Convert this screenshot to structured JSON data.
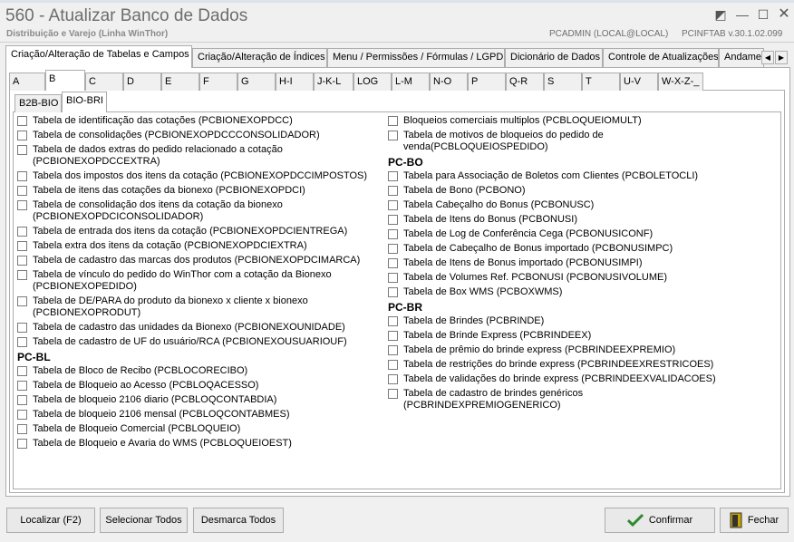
{
  "window": {
    "title": "560 - Atualizar Banco de Dados",
    "subtitle": "Distribuição e Varejo (Linha WinThor)",
    "user": "PCADMIN (LOCAL@LOCAL)",
    "module": "PCINFTAB  v.30.1.02.099",
    "controls": {
      "restore": "◩",
      "minimize": "—",
      "maximize": "☐",
      "close": "✕"
    }
  },
  "main_tabs": [
    {
      "label": "Criação/Alteração de Tabelas e Campos",
      "active": true
    },
    {
      "label": "Criação/Alteração de Índices",
      "active": false
    },
    {
      "label": "Menu / Permissões / Fórmulas / LGPD",
      "active": false
    },
    {
      "label": "Dicionário de Dados",
      "active": false
    },
    {
      "label": "Controle de Atualizações",
      "active": false
    },
    {
      "label": "Andame",
      "active": false
    }
  ],
  "tab_scroll": {
    "left": "◀",
    "right": "▶"
  },
  "letter_tabs": [
    {
      "label": "A",
      "active": false
    },
    {
      "label": "B",
      "active": true
    },
    {
      "label": "C",
      "active": false
    },
    {
      "label": "D",
      "active": false
    },
    {
      "label": "E",
      "active": false
    },
    {
      "label": "F",
      "active": false
    },
    {
      "label": "G",
      "active": false
    },
    {
      "label": "H-I",
      "active": false
    },
    {
      "label": "J-K-L",
      "active": false
    },
    {
      "label": "LOG",
      "active": false
    },
    {
      "label": "L-M",
      "active": false
    },
    {
      "label": "N-O",
      "active": false
    },
    {
      "label": "P",
      "active": false
    },
    {
      "label": "Q-R",
      "active": false
    },
    {
      "label": "S",
      "active": false
    },
    {
      "label": "T",
      "active": false
    },
    {
      "label": "U-V",
      "active": false
    },
    {
      "label": "W-X-Z-_",
      "active": false
    }
  ],
  "sub_tabs": [
    {
      "label": "B2B-BIO",
      "active": false
    },
    {
      "label": "BIO-BRI",
      "active": true
    }
  ],
  "left_column": {
    "items": [
      "Tabela de identificação das cotações (PCBIONEXOPDCC)",
      "Tabela de consolidações (PCBIONEXOPDCCCONSOLIDADOR)",
      "Tabela de dados extras do pedido relacionado a cotação (PCBIONEXOPDCCEXTRA)",
      "Tabela dos impostos dos itens da cotação (PCBIONEXOPDCCIMPOSTOS)",
      "Tabela de itens das cotações da bionexo (PCBIONEXOPDCI)",
      "Tabela de consolidação dos itens da cotação da bionexo (PCBIONEXOPDCICONSOLIDADOR)",
      "Tabela de entrada dos itens da cotação (PCBIONEXOPDCIENTREGA)",
      "Tabela extra dos itens da cotação (PCBIONEXOPDCIEXTRA)",
      "Tabela de cadastro das marcas dos produtos (PCBIONEXOPDCIMARCA)",
      "Tabela de vínculo do pedido do WinThor com a cotação da Bionexo (PCBIONEXOPEDIDO)",
      "Tabela de DE/PARA do produto da bionexo x cliente x bionexo (PCBIONEXOPRODUT)",
      "Tabela de cadastro das unidades da Bionexo (PCBIONEXOUNIDADE)",
      "Tabela de cadastro de UF do usuário/RCA (PCBIONEXOUSUARIOUF)"
    ],
    "section_pcbl": "PC-BL",
    "pcbl_items": [
      "Tabela de Bloco de Recibo (PCBLOCORECIBO)",
      "Tabela de Bloqueio ao Acesso (PCBLOQACESSO)",
      "Tabela de bloqueio 2106 diario (PCBLOQCONTABDIA)",
      "Tabela de bloqueio 2106 mensal (PCBLOQCONTABMES)",
      "Tabela de Bloqueio Comercial (PCBLOQUEIO)",
      "Tabela de Bloqueio e Avaria do WMS (PCBLOQUEIOEST)"
    ]
  },
  "right_column": {
    "top_items": [
      "Bloqueios comerciais multiplos (PCBLOQUEIOMULT)",
      "Tabela de motivos de bloqueios do pedido de venda(PCBLOQUEIOSPEDIDO)"
    ],
    "section_pcbo": "PC-BO",
    "pcbo_items": [
      "Tabela para Associação de Boletos com Clientes (PCBOLETOCLI)",
      "Tabela de Bono (PCBONO)",
      "Tabela Cabeçalho do Bonus (PCBONUSC)",
      "Tabela de Itens do Bonus (PCBONUSI)",
      "Tabela de Log de Conferência Cega (PCBONUSICONF)",
      "Tabela de Cabeçalho de Bonus importado (PCBONUSIMPC)",
      "Tabela de Itens de Bonus importado (PCBONUSIMPI)",
      "Tabela de Volumes Ref. PCBONUSI (PCBONUSIVOLUME)",
      "Tabela de Box WMS (PCBOXWMS)"
    ],
    "section_pcbr": "PC-BR",
    "pcbr_items": [
      "Tabela de Brindes (PCBRINDE)",
      "Tabela de Brinde Express (PCBRINDEEX)",
      "Tabela de prêmio do brinde express (PCBRINDEEXPREMIO)",
      "Tabela de restrições do brinde express (PCBRINDEEXRESTRICOES)",
      "Tabela de validações do brinde express (PCBRINDEEXVALIDACOES)",
      "Tabela de cadastro de brindes genéricos (PCBRINDEXPREMIOGENERICO)"
    ]
  },
  "buttons": {
    "localizar": "Localizar (F2)",
    "selecionar": "Selecionar Todos",
    "desmarca": "Desmarca Todos",
    "confirmar": "Confirmar",
    "fechar": "Fechar"
  },
  "icons": {
    "confirmar": "checkmark-icon",
    "fechar": "exit-door-icon"
  },
  "colors": {
    "confirm_check": "#2f8a2f",
    "exit_door": "#c8a200"
  }
}
